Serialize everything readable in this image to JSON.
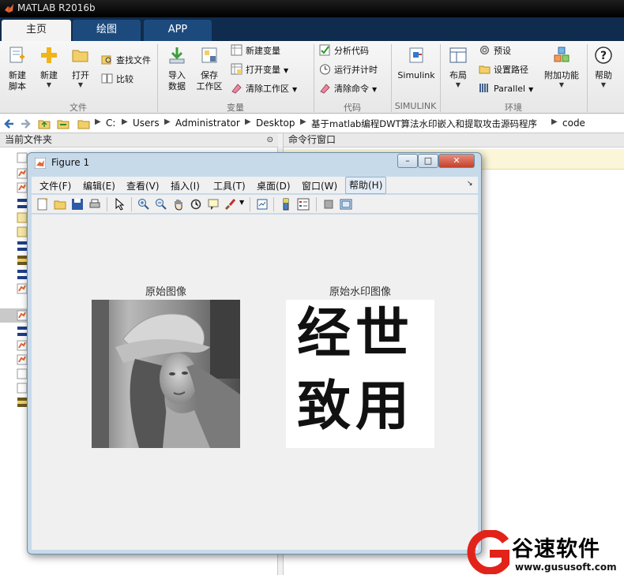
{
  "window": {
    "title": "MATLAB R2016b"
  },
  "tabs": [
    {
      "label": "主页",
      "active": true
    },
    {
      "label": "绘图",
      "active": false
    },
    {
      "label": "APP",
      "active": false
    }
  ],
  "ribbon": {
    "file": {
      "new_script": "新建\n脚本",
      "new": "新建",
      "open": "打开",
      "find_files": "查找文件",
      "compare": "比较",
      "group": "文件"
    },
    "variable": {
      "import": "导入\n数据",
      "save_workspace": "保存\n工作区",
      "new_variable": "新建变量",
      "open_variable": "打开变量",
      "clear_workspace": "清除工作区",
      "group": "变量"
    },
    "code": {
      "analyze": "分析代码",
      "run_time": "运行并计时",
      "clear_commands": "清除命令",
      "group": "代码"
    },
    "simulink": {
      "label": "Simulink",
      "group": "SIMULINK"
    },
    "environment": {
      "layout": "布局",
      "preferences": "预设",
      "set_path": "设置路径",
      "parallel": "Parallel",
      "addons": "附加功能",
      "group": "环境"
    },
    "help": {
      "label": "帮助"
    }
  },
  "address": {
    "crumbs": [
      "C:",
      "Users",
      "Administrator",
      "Desktop",
      "基于matlab编程DWT算法水印嵌入和提取攻击源码程序",
      "code"
    ]
  },
  "panels": {
    "current_folder": "当前文件夹",
    "command_window": "命令行窗口"
  },
  "figure": {
    "title": "Figure 1",
    "menu": [
      "文件(F)",
      "编辑(E)",
      "查看(V)",
      "插入(I)",
      "工具(T)",
      "桌面(D)",
      "窗口(W)",
      "帮助(H)"
    ],
    "axes": [
      {
        "title": "原始图像"
      },
      {
        "title": "原始水印图像",
        "watermark_lines": [
          "经世",
          "致用"
        ]
      }
    ]
  },
  "brand": {
    "name": "谷速软件",
    "url": "www.gususoft.com"
  },
  "colors": {
    "accent_tab": "#1d4a7d",
    "titlebar": "#000000",
    "brand_red": "#e2231a"
  }
}
